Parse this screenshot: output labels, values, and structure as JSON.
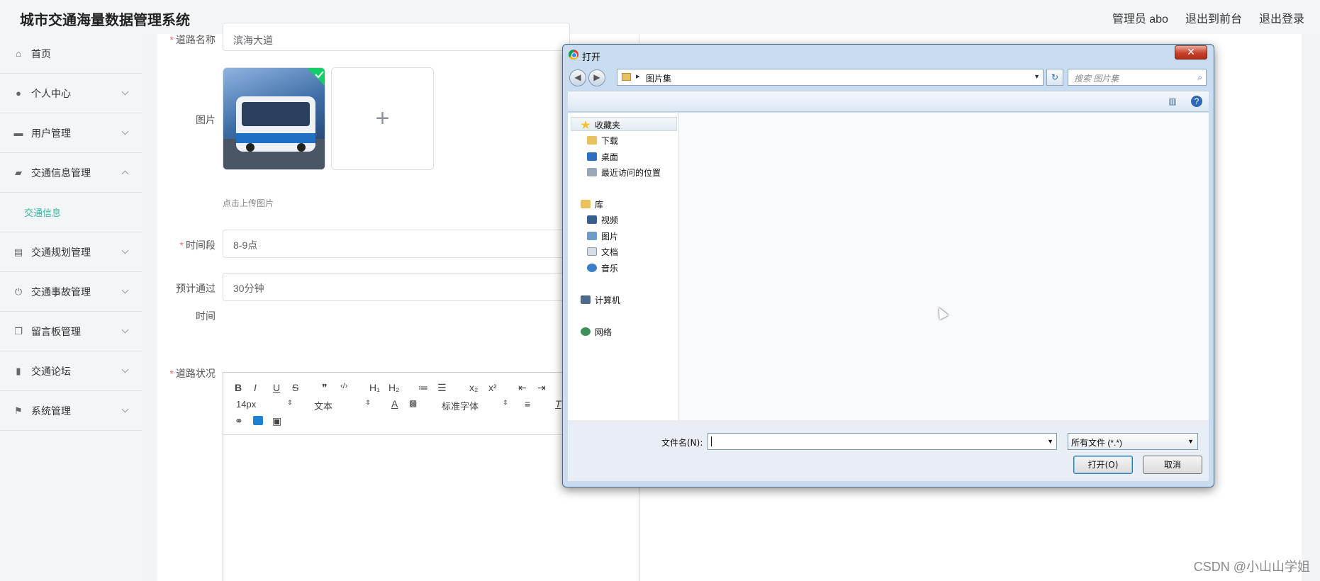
{
  "header": {
    "app_title": "城市交通海量数据管理系统",
    "admin_label": "管理员 abo",
    "to_front_label": "退出到前台",
    "logout_label": "退出登录"
  },
  "sidebar": {
    "items": [
      {
        "label": "首页",
        "icon": "home-icon"
      },
      {
        "label": "个人中心",
        "icon": "user-icon"
      },
      {
        "label": "用户管理",
        "icon": "chat-icon"
      },
      {
        "label": "交通信息管理",
        "icon": "briefcase-icon",
        "expanded": true,
        "sub": "交通信息"
      },
      {
        "label": "交通规划管理",
        "icon": "clipboard-icon"
      },
      {
        "label": "交通事故管理",
        "icon": "power-icon"
      },
      {
        "label": "留言板管理",
        "icon": "copy-icon"
      },
      {
        "label": "交通论坛",
        "icon": "bar-chart-icon"
      },
      {
        "label": "系统管理",
        "icon": "flag-icon"
      }
    ]
  },
  "form": {
    "road_name_label": "道路名称",
    "road_name_value": "滨海大道",
    "image_label": "图片",
    "upload_hint": "点击上传图片",
    "upload_plus": "+",
    "time_label": "时间段",
    "time_value": "8-9点",
    "pass_label_1": "预计通过",
    "pass_label_2": "时间",
    "pass_value": "30分钟",
    "status_label": "道路状况",
    "required_mark": "*"
  },
  "editor": {
    "font_size": "14px",
    "text_type": "文本",
    "font_family": "标准字体",
    "buttons": [
      "B",
      "I",
      "U",
      "S",
      "❞",
      "‹/›",
      "H₁",
      "H₂",
      "≔",
      "☰",
      "x₂",
      "x²",
      "⇤",
      "⇥"
    ]
  },
  "dialog": {
    "title": "打开",
    "close_label": "✕",
    "path": "图片集",
    "search_placeholder": "搜索 图片集",
    "nav": {
      "favorites": "收藏夹",
      "downloads": "下载",
      "desktop": "桌面",
      "recent": "最近访问的位置",
      "library": "库",
      "videos": "视频",
      "pictures": "图片",
      "documents": "文档",
      "music": "音乐",
      "computer": "计算机",
      "network": "网络"
    },
    "filename_label": "文件名(N):",
    "filename_value": "",
    "filetype_value": "所有文件 (*.*)",
    "open_button": "打开(O)",
    "cancel_button": "取消"
  },
  "watermark": "CSDN @小山山学姐",
  "colors": {
    "accent": "#3cb9a4",
    "required": "#f56c6c",
    "dialog_frame": "#c9dcf0"
  }
}
